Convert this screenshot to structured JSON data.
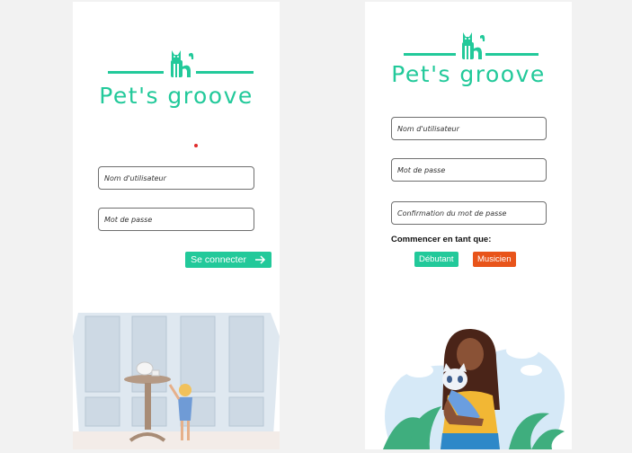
{
  "login_screen": {
    "app_name": "Pet's groove",
    "username_placeholder": "Nom d'utilisateur",
    "password_placeholder": "Mot de passe",
    "connect_label": "Se connecter",
    "connect_icon": "arrow-right-icon"
  },
  "signup_screen": {
    "app_name": "Pet's groove",
    "username_placeholder": "Nom d'utilisateur",
    "password_placeholder": "Mot de passe",
    "confirm_placeholder": "Confirmation du mot de passe",
    "start_as_label": "Commencer en tant que:",
    "role_options": [
      "Débutant",
      "Musicien"
    ]
  },
  "colors": {
    "brand": "#22c99a",
    "musician": "#e8541a",
    "error_dot": "#e02b2b"
  }
}
